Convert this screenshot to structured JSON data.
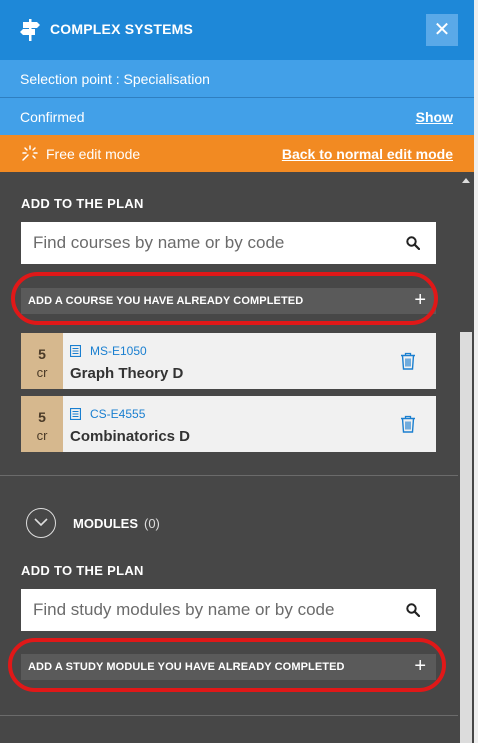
{
  "header": {
    "title": "COMPLEX SYSTEMS",
    "close_label": "✕"
  },
  "selection": {
    "label": "Selection point : Specialisation"
  },
  "status": {
    "label": "Confirmed",
    "show_label": "Show"
  },
  "edit_mode": {
    "label": "Free edit mode",
    "back_label": "Back to normal edit mode"
  },
  "courses_section": {
    "title": "ADD TO THE PLAN",
    "search_placeholder": "Find courses by name or by code",
    "add_completed_label": "ADD A COURSE YOU HAVE ALREADY COMPLETED",
    "items": [
      {
        "credits": "5",
        "unit": "cr",
        "code": "MS-E1050",
        "name": "Graph Theory D"
      },
      {
        "credits": "5",
        "unit": "cr",
        "code": "CS-E4555",
        "name": "Combinatorics D"
      }
    ]
  },
  "modules_section": {
    "toggle_label": "MODULES",
    "count": "(0)",
    "title": "ADD TO THE PLAN",
    "search_placeholder": "Find study modules by name or by code",
    "add_completed_label": "ADD A STUDY MODULE YOU HAVE ALREADY COMPLETED"
  },
  "colors": {
    "header": "#1e88d8",
    "info_bar": "#42a0e8",
    "edit_mode_bar": "#f28a22",
    "panel": "#474747",
    "credit_badge": "#d6b88e",
    "highlight": "#e01818"
  },
  "icons": {
    "logo": "signpost-icon",
    "close": "close-icon",
    "edit": "sparkle-icon",
    "search": "search-icon",
    "add": "plus-icon",
    "course": "document-icon",
    "remove": "trash-icon",
    "toggle": "chevron-down-icon"
  }
}
